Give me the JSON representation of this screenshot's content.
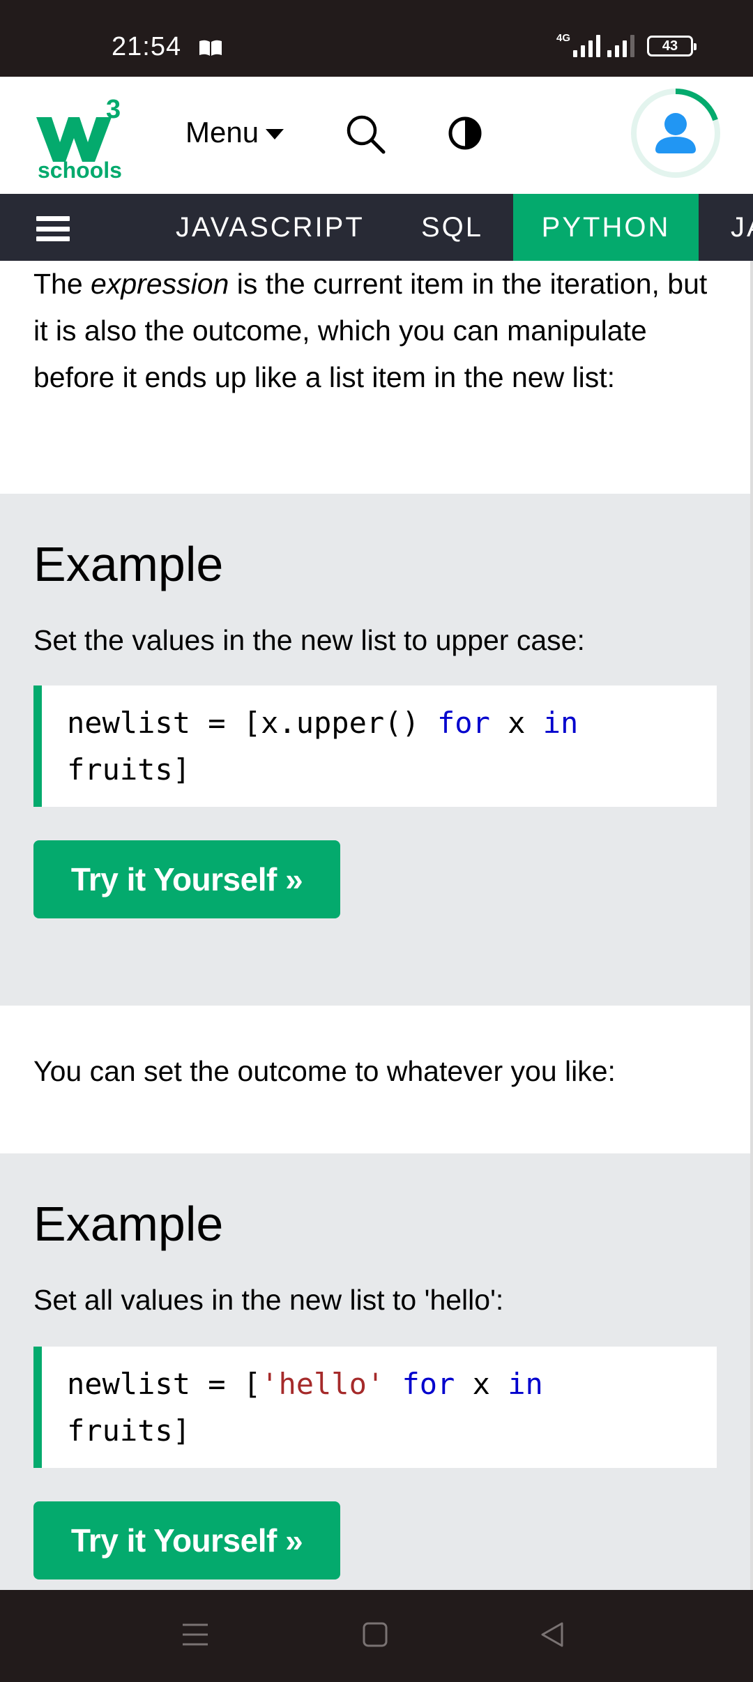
{
  "status_bar": {
    "time": "21:54",
    "network": "4G",
    "battery": "43"
  },
  "header": {
    "logo_superscript": "3",
    "logo_text": "schools",
    "menu_label": "Menu"
  },
  "nav": {
    "tabs": [
      {
        "label": "JAVASCRIPT",
        "active": false
      },
      {
        "label": "SQL",
        "active": false
      },
      {
        "label": "PYTHON",
        "active": true
      },
      {
        "label": "JA",
        "active": false
      }
    ]
  },
  "content": {
    "intro_pre": "The ",
    "intro_em": "expression",
    "intro_post": " is the current item in the iteration, but it is also the outcome, which you can manipulate before it ends up like a list item in the new list:",
    "example1": {
      "heading": "Example",
      "description": "Set the values in the new list to upper case:",
      "code_a": "newlist = [x.upper() ",
      "code_kw1": "for",
      "code_b": " x ",
      "code_kw2": "in",
      "code_c": "\nfruits]",
      "button": "Try it Yourself »"
    },
    "middle_text": "You can set the outcome to whatever you like:",
    "example2": {
      "heading": "Example",
      "description": "Set all values in the new list to 'hello':",
      "code_a": "newlist = [",
      "code_str": "'hello'",
      "code_kw1": "for",
      "code_b": " x ",
      "code_kw2": "in",
      "code_c": "\nfruits]",
      "button": "Try it Yourself »"
    }
  },
  "colors": {
    "brand_green": "#04aa6d",
    "nav_dark": "#282a35",
    "status_dark": "#221b1b",
    "example_bg": "#e7e9eb",
    "keyword_blue": "#0000cd",
    "string_red": "#a52a2a"
  },
  "icons": {
    "book": "book-icon",
    "search": "search-icon",
    "contrast": "contrast-icon",
    "user": "user-avatar-icon",
    "hamburger": "hamburger-menu-icon",
    "sys_menu": "recent-apps-icon",
    "sys_home": "home-icon",
    "sys_back": "back-icon"
  }
}
